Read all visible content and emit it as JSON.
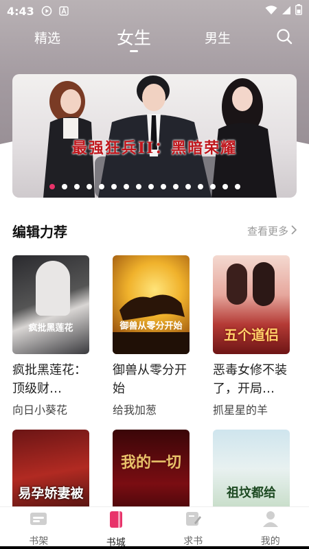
{
  "status_bar": {
    "time": "4:43",
    "icons": [
      "play-circle-icon",
      "font-icon",
      "wifi-icon",
      "signal-icon",
      "battery-icon"
    ]
  },
  "top_nav": {
    "tabs": [
      {
        "label": "精选",
        "active": false
      },
      {
        "label": "女生",
        "active": true
      },
      {
        "label": "男生",
        "active": false
      }
    ],
    "search_icon": "search-icon"
  },
  "banner": {
    "title": "最强狂兵II：黑暗荣耀",
    "dot_count": 16,
    "active_dot": 0
  },
  "section": {
    "title": "编辑力荐",
    "more_label": "查看更多"
  },
  "books": [
    {
      "title": "疯批黑莲花：顶级财…",
      "author": "向日小葵花",
      "cover_text": "疯批黑莲花"
    },
    {
      "title": "御兽从零分开始",
      "author": "给我加葱",
      "cover_text": "御兽从零分开始"
    },
    {
      "title": "恶毒女修不装了，开局…",
      "author": "抓星星的羊",
      "cover_text": "五个道侣"
    },
    {
      "title": "",
      "author": "",
      "cover_text": "易孕娇妻被"
    },
    {
      "title": "",
      "author": "",
      "cover_text": "我的一切"
    },
    {
      "title": "",
      "author": "",
      "cover_text": "祖坟都给"
    }
  ],
  "bottom_nav": [
    {
      "label": "书架",
      "icon": "bookshelf-icon",
      "active": false
    },
    {
      "label": "书城",
      "icon": "bookstore-icon",
      "active": true
    },
    {
      "label": "求书",
      "icon": "request-book-icon",
      "active": false
    },
    {
      "label": "我的",
      "icon": "profile-icon",
      "active": false
    }
  ],
  "colors": {
    "accent": "#e8336a",
    "banner_title": "#c0171d"
  }
}
